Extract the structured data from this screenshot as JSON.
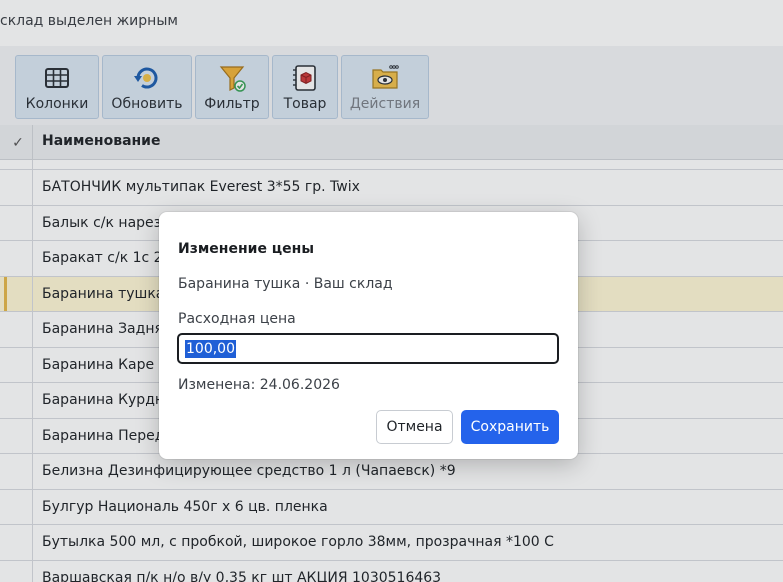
{
  "hint": {
    "text": "склад выделен жирным"
  },
  "toolbar": {
    "columns_label": "Колонки",
    "refresh_label": "Обновить",
    "filter_label": "Фильтр",
    "product_label": "Товар",
    "actions_label": "Действия"
  },
  "grid": {
    "check_header": "✓",
    "name_header": "Наименование",
    "rows": [
      "БАТОНЧИК мультипак Everest 3*55 гр. Twix",
      "Балык с/к нарезка",
      "Баракат с/к 1с 200г",
      "Баранина тушка",
      "Баранина Задняя",
      "Баранина Каре",
      "Баранина Курдюк",
      "Баранина Передняя",
      "Белизна Дезинфицирующее средство 1 л (Чапаевск) *9",
      "Булгур Националь 450г х 6 цв. пленка",
      "Бутылка 500 мл, с пробкой, широкое горло 38мм, прозрачная *100 С",
      "Варшавская п/к н/о в/у 0,35 кг шт АКЦИЯ 1030516463"
    ],
    "selected_row": "Баранина тушка"
  },
  "dialog": {
    "title": "Изменение цены",
    "subtitle": "Баранина тушка · Ваш склад",
    "field_label": "Расходная цена",
    "field_value": "100,00",
    "changed": "Изменена: 24.06.2026",
    "cancel_label": "Отмена",
    "save_label": "Сохранить"
  },
  "colors": {
    "accent": "#2463eb",
    "selected_row": "#fff7d6",
    "toolbar_button": "#dbe7f3"
  }
}
